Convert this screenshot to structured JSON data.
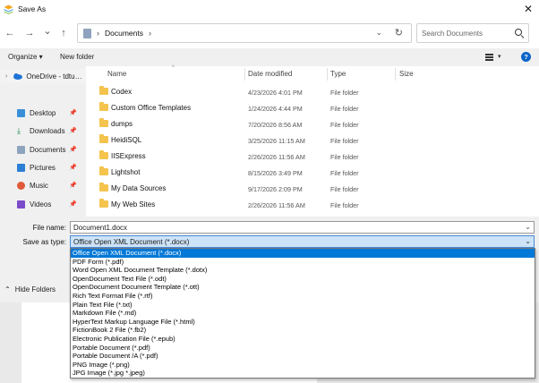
{
  "window": {
    "title": "Save As"
  },
  "nav": {
    "back": "←",
    "forward": "→",
    "recent": "⌄",
    "up": "↑",
    "address": {
      "crumb": "Documents",
      "chevron": "›"
    },
    "search_placeholder": "Search Documents"
  },
  "toolbar": {
    "organize": "Organize ▾",
    "new_folder": "New folder"
  },
  "sidebar": {
    "items": [
      {
        "label": "OneDrive - tdtu…",
        "icon": "cloud-icon"
      },
      {
        "label": "Desktop",
        "icon": "desktop-icon"
      },
      {
        "label": "Downloads",
        "icon": "download-icon"
      },
      {
        "label": "Documents",
        "icon": "documents-icon"
      },
      {
        "label": "Pictures",
        "icon": "pictures-icon"
      },
      {
        "label": "Music",
        "icon": "music-icon"
      },
      {
        "label": "Videos",
        "icon": "videos-icon"
      }
    ]
  },
  "columns": {
    "name": "Name",
    "date": "Date modified",
    "type": "Type",
    "size": "Size"
  },
  "files": [
    {
      "name": "Codex",
      "date": "4/23/2026 4:01 PM",
      "type": "File folder"
    },
    {
      "name": "Custom Office Templates",
      "date": "1/24/2026 4:44 PM",
      "type": "File folder"
    },
    {
      "name": "dumps",
      "date": "7/20/2026 8:56 AM",
      "type": "File folder"
    },
    {
      "name": "HeidiSQL",
      "date": "3/25/2026 11:15 AM",
      "type": "File folder"
    },
    {
      "name": "IISExpress",
      "date": "2/26/2026 11:56 AM",
      "type": "File folder"
    },
    {
      "name": "Lightshot",
      "date": "8/15/2026 3:49 PM",
      "type": "File folder"
    },
    {
      "name": "My Data Sources",
      "date": "9/17/2026 2:09 PM",
      "type": "File folder"
    },
    {
      "name": "My Web Sites",
      "date": "2/26/2026 11:56 AM",
      "type": "File folder"
    }
  ],
  "form": {
    "filename_label": "File name:",
    "filename_value": "Document1.docx",
    "savetype_label": "Save as type:",
    "savetype_value": "Office Open XML Document (*.docx)"
  },
  "hide_folders": "Hide Folders",
  "type_options": [
    "Office Open XML Document (*.docx)",
    "PDF Form (*.pdf)",
    "Word Open XML Document Template (*.dotx)",
    "OpenDocument Text File (*.odt)",
    "OpenDocument Document Template (*.ott)",
    "Rich Text Format File (*.rtf)",
    "Plain Text File (*.txt)",
    "Markdown File (*.md)",
    "HyperText Markup Language File (*.html)",
    "FictionBook 2 File (*.fb2)",
    "Electronic Publication File (*.epub)",
    "Portable Document (*.pdf)",
    "Portable Document /A (*.pdf)",
    "PNG Image (*.png)",
    "JPG Image (*.jpg *.jpeg)"
  ],
  "colors": {
    "accent": "#0078d7",
    "folder": "#f4c44e"
  }
}
